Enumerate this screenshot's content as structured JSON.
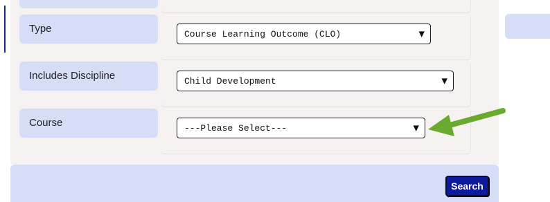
{
  "form": {
    "rows": [
      {
        "label": "Type",
        "value": "Course Learning Outcome (CLO)"
      },
      {
        "label": "Includes Discipline",
        "value": "Child Development"
      },
      {
        "label": "Course",
        "value": "---Please Select---"
      }
    ],
    "dropdown_caret": "▼"
  },
  "actions": {
    "search_label": "Search"
  },
  "colors": {
    "label_bg": "#d6def7",
    "panel_bg": "#f7f2f2",
    "button_bg": "#0d1a9b",
    "annotation_arrow": "#6aaa2e"
  },
  "annotation": {
    "icon": "arrow-left-icon"
  }
}
